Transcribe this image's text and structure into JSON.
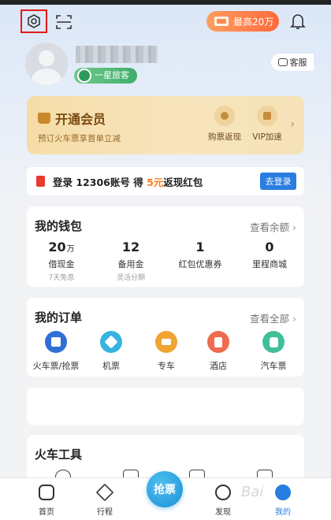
{
  "topbar": {
    "settings_icon": "gear-hexagon-icon",
    "scan_icon": "scan-icon",
    "max_badge_label": "最高20万",
    "bell_icon": "bell-icon"
  },
  "profile": {
    "level_label": "一星旅客",
    "service_label": "客服"
  },
  "vip": {
    "title": "开通会员",
    "subtitle": "预订火车票享首单立减",
    "features": [
      "购票返现",
      "VIP加速"
    ]
  },
  "login_bar": {
    "text_prefix": "登录 12306账号 得",
    "amount": "5元",
    "text_suffix": "返现红包",
    "button": "去登录"
  },
  "wallet": {
    "title": "我的钱包",
    "link": "查看余额",
    "items": [
      {
        "value": "20",
        "unit": "万",
        "label": "借现金",
        "sub": "7天免息"
      },
      {
        "value": "12",
        "unit": "",
        "label": "备用金",
        "sub": "灵活分期"
      },
      {
        "value": "1",
        "unit": "",
        "label": "红包优惠券",
        "sub": ""
      },
      {
        "value": "0",
        "unit": "",
        "label": "里程商城",
        "sub": ""
      }
    ]
  },
  "orders": {
    "title": "我的订单",
    "link": "查看全部",
    "items": [
      {
        "label": "火车票/抢票",
        "color": "#2f6fd6"
      },
      {
        "label": "机票",
        "color": "#36b3e0"
      },
      {
        "label": "专车",
        "color": "#f0a431"
      },
      {
        "label": "酒店",
        "color": "#ee6b4d"
      },
      {
        "label": "汽车票",
        "color": "#3fbf9a"
      }
    ]
  },
  "tools": {
    "title": "火车工具"
  },
  "tabbar": {
    "items": [
      "首页",
      "行程",
      "发现",
      "我的"
    ],
    "center_button": "抢票",
    "active": "我的"
  },
  "watermark": "Bai"
}
